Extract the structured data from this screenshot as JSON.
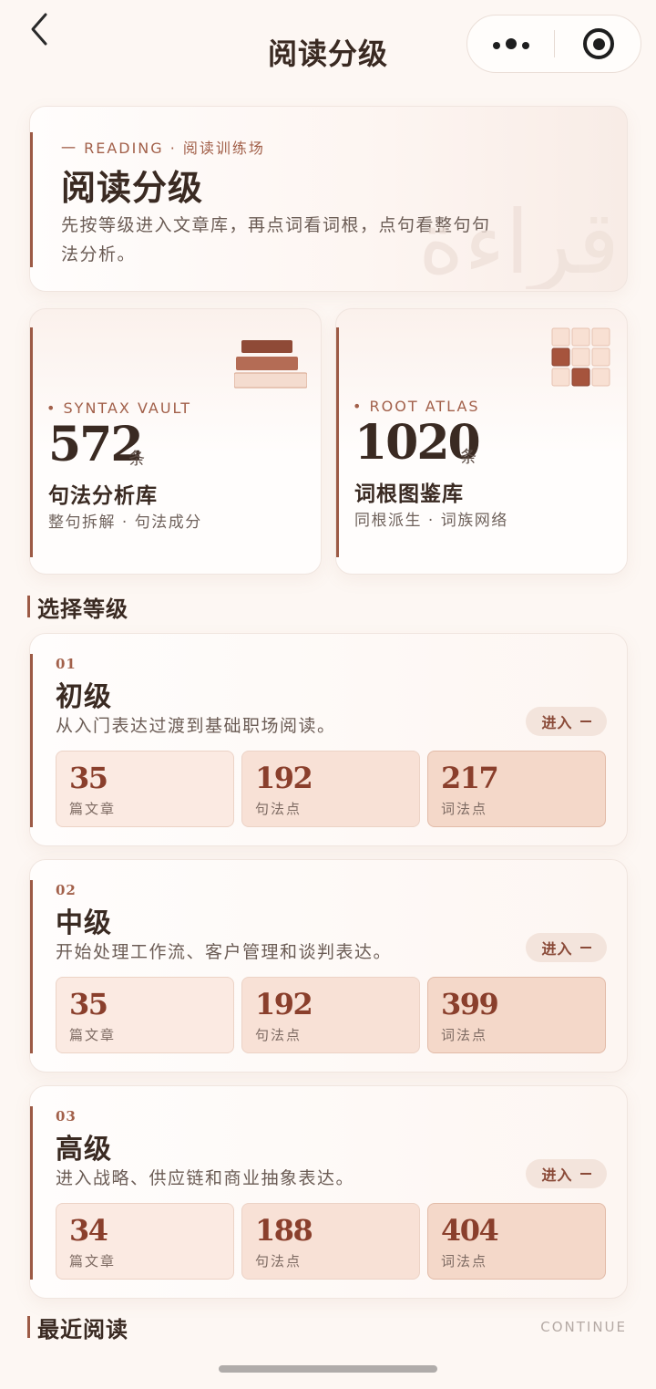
{
  "nav": {
    "title": "阅读分级"
  },
  "hero": {
    "eyebrow": "一 READING · 阅读训练场",
    "title": "阅读分级",
    "description": "先按等级进入文章库，再点词看词根，点句看整句句法分析。",
    "watermark": "قراءة"
  },
  "stats": [
    {
      "eyebrow": "• SYNTAX VAULT",
      "value": "572",
      "unit": "条",
      "title": "句法分析库",
      "subtitle": "整句拆解 · 句法成分"
    },
    {
      "eyebrow": "• ROOT ATLAS",
      "value": "1020",
      "unit": "条",
      "title": "词根图鉴库",
      "subtitle": "同根派生 · 词族网络"
    }
  ],
  "sections": {
    "levels": "选择等级",
    "recent": "最近阅读",
    "continue": "CONTINUE"
  },
  "levels": [
    {
      "num": "01",
      "name": "初级",
      "desc": "从入门表达过渡到基础职场阅读。",
      "enter": "进入",
      "metrics": [
        {
          "value": "35",
          "label": "篇文章"
        },
        {
          "value": "192",
          "label": "句法点"
        },
        {
          "value": "217",
          "label": "词法点"
        }
      ]
    },
    {
      "num": "02",
      "name": "中级",
      "desc": "开始处理工作流、客户管理和谈判表达。",
      "enter": "进入",
      "metrics": [
        {
          "value": "35",
          "label": "篇文章"
        },
        {
          "value": "192",
          "label": "句法点"
        },
        {
          "value": "399",
          "label": "词法点"
        }
      ]
    },
    {
      "num": "03",
      "name": "高级",
      "desc": "进入战略、供应链和商业抽象表达。",
      "enter": "进入",
      "metrics": [
        {
          "value": "34",
          "label": "篇文章"
        },
        {
          "value": "188",
          "label": "句法点"
        },
        {
          "value": "404",
          "label": "词法点"
        }
      ]
    }
  ],
  "icons": {
    "back": "chevron-left-icon",
    "more": "more-dots-icon",
    "close": "target-close-icon",
    "books": "book-stack-icon",
    "grid": "grid-tiles-icon"
  },
  "colors": {
    "accent": "#9c5a45",
    "metric_value": "#8a3f2c",
    "background": "#fdf7f3"
  }
}
